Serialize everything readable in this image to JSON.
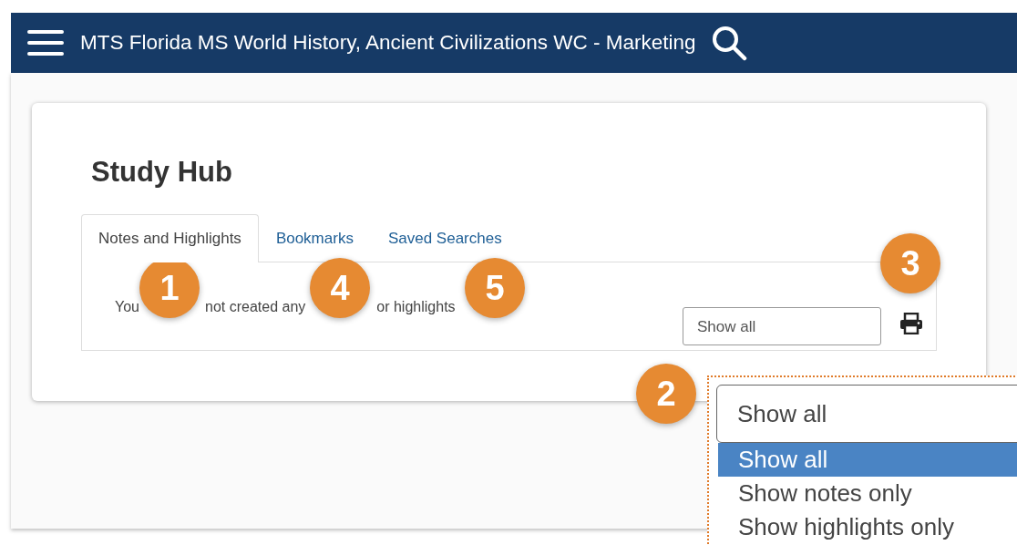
{
  "header": {
    "title": "MTS Florida MS World History, Ancient Civilizations WC - Marketing"
  },
  "page": {
    "title": "Study Hub"
  },
  "tabs": [
    {
      "label": "Notes and Highlights",
      "selected": true
    },
    {
      "label": "Bookmarks",
      "selected": false
    },
    {
      "label": "Saved Searches",
      "selected": false
    }
  ],
  "message_parts": [
    "You",
    "not created any",
    "or highlights"
  ],
  "filter": {
    "value": "Show all"
  },
  "dropdown": {
    "value": "Show all",
    "options": [
      {
        "label": "Show all",
        "selected": true
      },
      {
        "label": "Show notes only",
        "selected": false
      },
      {
        "label": "Show highlights only",
        "selected": false
      }
    ]
  },
  "callouts": [
    "1",
    "4",
    "5",
    "3",
    "2"
  ]
}
